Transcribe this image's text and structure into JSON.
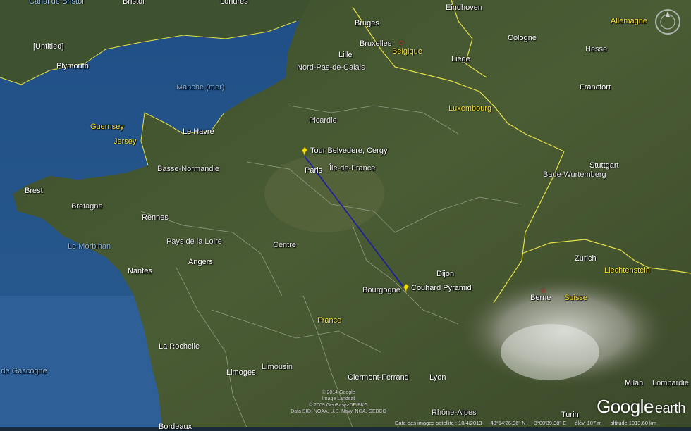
{
  "map": {
    "places": [
      {
        "id": "canal-de-bristol",
        "text": "Canal de Bristol",
        "cls": "sea2"
      },
      {
        "id": "bristol",
        "text": "Bristol",
        "cls": ""
      },
      {
        "id": "londres",
        "text": "Londres",
        "cls": ""
      },
      {
        "id": "eindhoven",
        "text": "Eindhoven",
        "cls": ""
      },
      {
        "id": "allemagne",
        "text": "Allemagne",
        "cls": "country"
      },
      {
        "id": "bruges",
        "text": "Bruges",
        "cls": ""
      },
      {
        "id": "bruxelles",
        "text": "Bruxelles",
        "cls": ""
      },
      {
        "id": "cologne",
        "text": "Cologne",
        "cls": ""
      },
      {
        "id": "untitled",
        "text": "[Untitled]",
        "cls": ""
      },
      {
        "id": "belgique",
        "text": "Belgique",
        "cls": "country"
      },
      {
        "id": "lille",
        "text": "Lille",
        "cls": ""
      },
      {
        "id": "liege",
        "text": "Liège",
        "cls": ""
      },
      {
        "id": "hesse",
        "text": "Hesse",
        "cls": "region"
      },
      {
        "id": "plymouth",
        "text": "Plymouth",
        "cls": ""
      },
      {
        "id": "nord-pas-de-calais",
        "text": "Nord-Pas-de-Calais",
        "cls": "region"
      },
      {
        "id": "manche",
        "text": "Manche (mer)",
        "cls": "sea"
      },
      {
        "id": "francfort",
        "text": "Francfort",
        "cls": ""
      },
      {
        "id": "luxembourg",
        "text": "Luxembourg",
        "cls": "country"
      },
      {
        "id": "picardie",
        "text": "Picardie",
        "cls": "region"
      },
      {
        "id": "guernsey",
        "text": "Guernsey",
        "cls": "country"
      },
      {
        "id": "le-havre",
        "text": "Le Havre",
        "cls": ""
      },
      {
        "id": "jersey",
        "text": "Jersey",
        "cls": "country"
      },
      {
        "id": "stuttgart",
        "text": "Stuttgart",
        "cls": ""
      },
      {
        "id": "basse-normandie",
        "text": "Basse-Normandie",
        "cls": "region"
      },
      {
        "id": "paris",
        "text": "Paris",
        "cls": ""
      },
      {
        "id": "ile-de-france",
        "text": "Île-de-France",
        "cls": "region"
      },
      {
        "id": "bade-wurtemberg",
        "text": "Bade-Wurtemberg",
        "cls": "region"
      },
      {
        "id": "brest",
        "text": "Brest",
        "cls": ""
      },
      {
        "id": "bretagne",
        "text": "Bretagne",
        "cls": "region"
      },
      {
        "id": "rennes",
        "text": "Rennes",
        "cls": ""
      },
      {
        "id": "pays-de-la-loire",
        "text": "Pays de la Loire",
        "cls": "region"
      },
      {
        "id": "le-morbihan",
        "text": "Le Morbihan",
        "cls": "sea"
      },
      {
        "id": "centre",
        "text": "Centre",
        "cls": "region"
      },
      {
        "id": "angers",
        "text": "Angers",
        "cls": ""
      },
      {
        "id": "zurich",
        "text": "Zurich",
        "cls": ""
      },
      {
        "id": "nantes",
        "text": "Nantes",
        "cls": ""
      },
      {
        "id": "dijon",
        "text": "Dijon",
        "cls": ""
      },
      {
        "id": "liechtenstein",
        "text": "Liechtenstein",
        "cls": "country"
      },
      {
        "id": "bourgogne",
        "text": "Bourgogne",
        "cls": "region"
      },
      {
        "id": "berne",
        "text": "Berne",
        "cls": ""
      },
      {
        "id": "suisse",
        "text": "Suisse",
        "cls": "country"
      },
      {
        "id": "france",
        "text": "France",
        "cls": "country"
      },
      {
        "id": "la-rochelle",
        "text": "La Rochelle",
        "cls": ""
      },
      {
        "id": "golfe-de-gascogne",
        "text": "Golfe de Gascogne",
        "cls": "sea"
      },
      {
        "id": "limousin",
        "text": "Limousin",
        "cls": "region"
      },
      {
        "id": "limoges",
        "text": "Limoges",
        "cls": ""
      },
      {
        "id": "clermont-ferrand",
        "text": "Clermont-Ferrand",
        "cls": ""
      },
      {
        "id": "lyon",
        "text": "Lyon",
        "cls": ""
      },
      {
        "id": "milan",
        "text": "Milan",
        "cls": ""
      },
      {
        "id": "lombardie",
        "text": "Lombardie",
        "cls": "region"
      },
      {
        "id": "rhone-alpes",
        "text": "Rhône-Alpes",
        "cls": "region"
      },
      {
        "id": "turin",
        "text": "Turin",
        "cls": ""
      },
      {
        "id": "bordeaux",
        "text": "Bordeaux",
        "cls": ""
      }
    ],
    "pins": [
      {
        "id": "tour-belvedere",
        "text": "Tour Belvedere, Cergy"
      },
      {
        "id": "couhard-pyramid",
        "text": "Couhard Pyramid"
      }
    ],
    "path_color": "#1a1aa8",
    "pin_color": "#f5e000"
  },
  "attribution": {
    "line1": "© 2014 Google",
    "line2": "Image Landsat",
    "line3": "© 2009 GeoBasis-DE/BKG",
    "line4": "Data SIO, NOAA, U.S. Navy, NGA, GEBCO"
  },
  "status": {
    "date": "Date des images satellite : 10/4/2013",
    "lat": "48°14'26.96\" N",
    "lon": "3°00'39.38\" E",
    "elev": "élév.  107 m",
    "alt": "altitude 1013.60 km"
  },
  "logo": {
    "google": "Google",
    "earth": "earth"
  }
}
